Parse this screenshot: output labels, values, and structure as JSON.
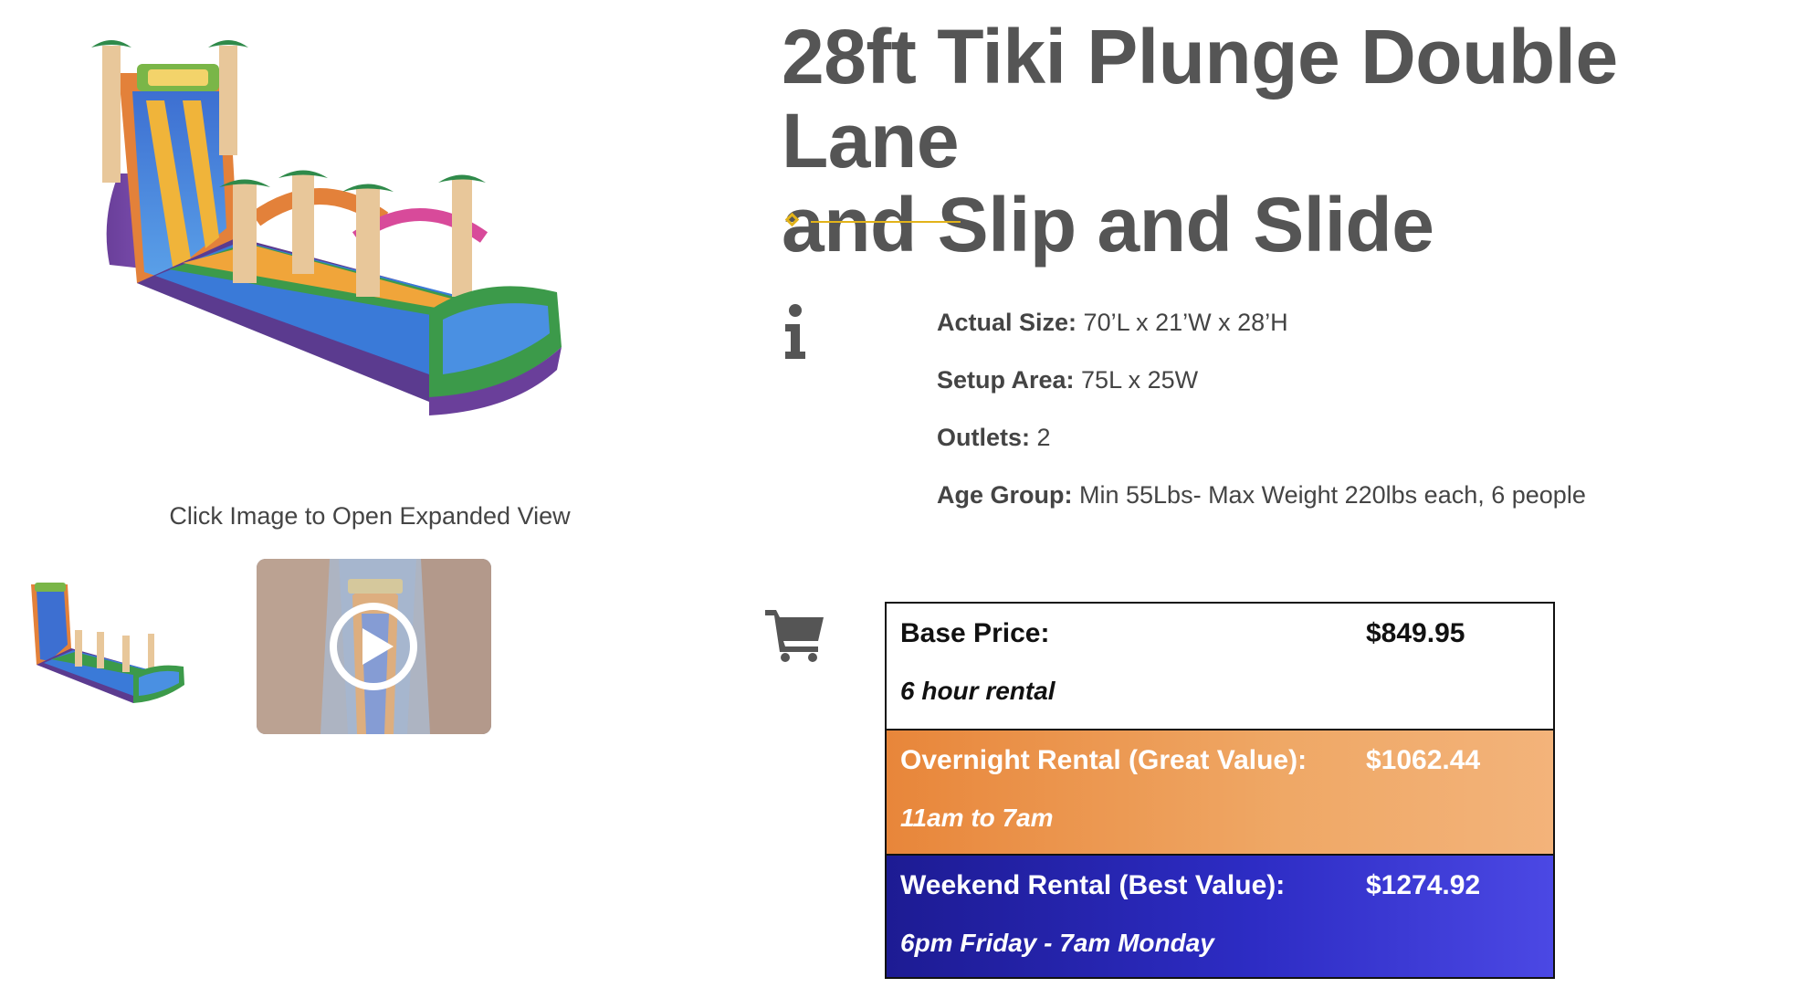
{
  "gallery": {
    "main_image_alt": "28ft Tiki Plunge Double Lane and Slip and Slide",
    "caption": "Click Image to Open Expanded View"
  },
  "product": {
    "title_line1": "28ft Tiki Plunge Double Lane",
    "title_line2": "and Slip and Slide",
    "accent_color": "#e2b31a",
    "specs": [
      {
        "label": "Actual Size:",
        "value": " 70’L x 21’W x 28’H"
      },
      {
        "label": "Setup Area:",
        "value": " 75L x 25W"
      },
      {
        "label": "Outlets:",
        "value": " 2"
      },
      {
        "label": "Age Group:",
        "value": " Min 55Lbs- Max Weight 220lbs each, 6 people"
      }
    ]
  },
  "pricing": {
    "rows": [
      {
        "label": "Base Price:",
        "price": "$849.95",
        "note": "6 hour rental"
      },
      {
        "label": "Overnight Rental (Great Value):",
        "price": "$1062.44",
        "note": "11am to 7am"
      },
      {
        "label": "Weekend Rental (Best Value):",
        "price": "$1274.92",
        "note": "6pm Friday - 7am Monday"
      }
    ]
  },
  "icons": {
    "info": "info-icon",
    "cart": "shopping-cart-icon",
    "play": "play-icon"
  }
}
